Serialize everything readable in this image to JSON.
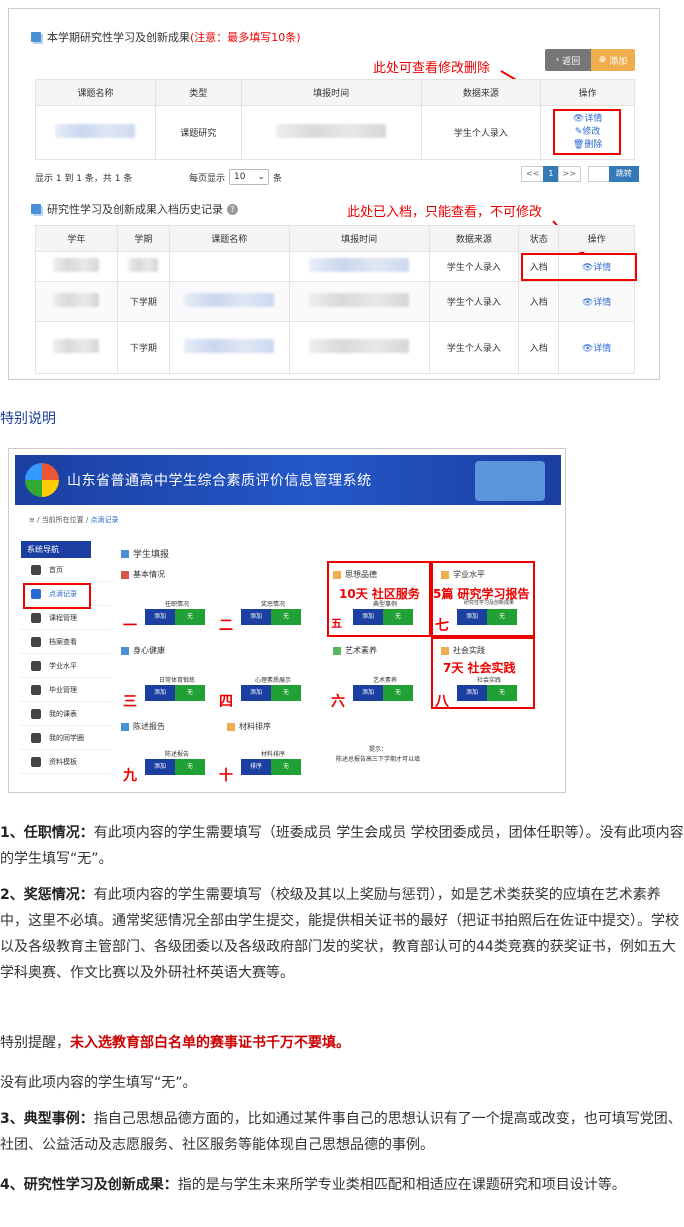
{
  "shot1": {
    "section1_title": "本学期研究性学习及创新成果",
    "section1_warning": "(注意：最多填写10条)",
    "back_label": "返回",
    "add_label": "添加",
    "annotation1": "此处可查看修改删除",
    "table1_headers": [
      "课题名称",
      "类型",
      "填报时间",
      "数据来源",
      "操作"
    ],
    "table1_row": {
      "type": "课题研究",
      "source": "学生个人录入",
      "op_detail": "详情",
      "op_edit": "修改",
      "op_delete": "删除"
    },
    "pager_info": "显示 1 到 1 条，共 1 条",
    "per_page_label": "每页显示",
    "per_page_value": "10",
    "per_page_unit": "条",
    "pager": {
      "prev": "<<",
      "current": "1",
      "next": ">>",
      "jump": "跳转"
    },
    "section2_title": "研究性学习及创新成果入档历史记录",
    "annotation2": "此处已入档，只能查看，不可修改",
    "table2_headers": [
      "学年",
      "学期",
      "课题名称",
      "填报时间",
      "数据来源",
      "状态",
      "操作"
    ],
    "table2_rows": [
      {
        "term": "",
        "source": "学生个人录入",
        "status": "入档",
        "op": "详情"
      },
      {
        "term": "下学期",
        "source": "学生个人录入",
        "status": "入档",
        "op": "详情"
      },
      {
        "term": "下学期",
        "source": "学生个人录入",
        "status": "入档",
        "op": "详情"
      }
    ]
  },
  "special_heading": "特别说明",
  "shot2": {
    "banner_title": "山东省普通高中学生综合素质评价信息管理系统",
    "crumb_home": "当前所在位置",
    "crumb_current": "点滴记录",
    "nav_header": "系统导航",
    "nav_items": [
      "首页",
      "点滴记录",
      "课程管理",
      "档案查看",
      "学业水平",
      "毕业管理",
      "我的课表",
      "我的同学圈",
      "资料模板"
    ],
    "main_title": "学生填报",
    "sections": {
      "basic": "基本情况",
      "morality": "思想品德",
      "academic": "学业水平",
      "health": "身心健康",
      "art": "艺术素养",
      "social": "社会实践",
      "report": "陈述报告",
      "sort": "材料排序"
    },
    "cards": [
      {
        "num": "一",
        "label": "任职情况",
        "b1": "添加",
        "b2": "无"
      },
      {
        "num": "二",
        "label": "奖惩情况",
        "b1": "添加",
        "b2": "无"
      },
      {
        "num": "五",
        "label": "典型事例",
        "b1": "添加",
        "b2": "无"
      },
      {
        "num": "七",
        "label": "研究性学习及创新成果",
        "b1": "添加",
        "b2": "无"
      },
      {
        "num": "三",
        "label": "日常体育锻炼",
        "b1": "添加",
        "b2": "无"
      },
      {
        "num": "四",
        "label": "心理素质展示",
        "b1": "添加",
        "b2": "无"
      },
      {
        "num": "六",
        "label": "艺术素养",
        "b1": "添加",
        "b2": "无"
      },
      {
        "num": "八",
        "label": "社会实践",
        "b1": "添加",
        "b2": "无"
      },
      {
        "num": "九",
        "label": "陈述报告",
        "b1": "添加",
        "b2": "无"
      },
      {
        "num": "十",
        "label": "材料排序",
        "b1": "排序",
        "b2": "无"
      }
    ],
    "red_notes": [
      "10天 社区服务",
      "5篇 研究学习报告",
      "7天 社会实践"
    ],
    "tip_title": "提示：",
    "tip_text": "陈述总报告高三下学期才可以填"
  },
  "paragraphs": {
    "p1_label": "1、任职情况：",
    "p1_text": "有此项内容的学生需要填写（班委成员 学生会成员 学校团委成员，团体任职等）。没有此项内容的学生填写“无”。",
    "p2_label": "2、奖惩情况：",
    "p2_text": "有此项内容的学生需要填写（校级及其以上奖励与惩罚），如是艺术类获奖的应填在艺术素养中，这里不必填。通常奖惩情况全部由学生提交，能提供相关证书的最好（把证书拍照后在佐证中提交）。学校以及各级教育主管部门、各级团委以及各级政府部门发的奖状，教育部认可的44类竞赛的获奖证书，例如五大学科奥赛、作文比赛以及外研社杯英语大赛等。",
    "p3_prefix": "特别提醒，",
    "p3_highlight": "未入选教育部白名单的赛事证书千万不要填。",
    "p4_text": "没有此项内容的学生填写“无”。",
    "p5_label": "3、典型事例：",
    "p5_text": "指自己思想品德方面的，比如通过某件事自己的思想认识有了一个提高或改变，也可填写党团、社团、公益活动及志愿服务、社区服务等能体现自己思想品德的事例。",
    "p6_label": "4、研究性学习及创新成果：",
    "p6_text": "指的是与学生未来所学专业类相匹配和相适应在课题研究和项目设计等。"
  }
}
